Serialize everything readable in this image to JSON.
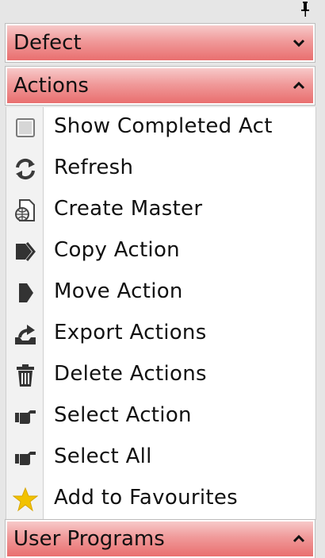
{
  "sections": {
    "defect": {
      "title": "Defect",
      "state": "collapsed"
    },
    "actions": {
      "title": "Actions",
      "state": "expanded"
    },
    "user_programs": {
      "title": "User Programs",
      "state": "expanded"
    }
  },
  "actions": {
    "items": [
      {
        "label": "Show Completed Act",
        "icon": "checkbox-icon"
      },
      {
        "label": "Refresh",
        "icon": "refresh-icon"
      },
      {
        "label": "Create Master",
        "icon": "document-globe-icon"
      },
      {
        "label": "Copy Action",
        "icon": "double-arrow-icon"
      },
      {
        "label": "Move Action",
        "icon": "arrow-tag-icon"
      },
      {
        "label": "Export Actions",
        "icon": "export-icon"
      },
      {
        "label": "Delete Actions",
        "icon": "trash-icon"
      },
      {
        "label": "Select Action",
        "icon": "pointing-hand-icon"
      },
      {
        "label": "Select All",
        "icon": "pointing-hand-icon"
      },
      {
        "label": "Add to Favourites",
        "icon": "star-icon"
      }
    ]
  },
  "colors": {
    "header_top": "#f7c9c9",
    "header_bottom": "#e96f6f",
    "star": "#f2c200"
  }
}
